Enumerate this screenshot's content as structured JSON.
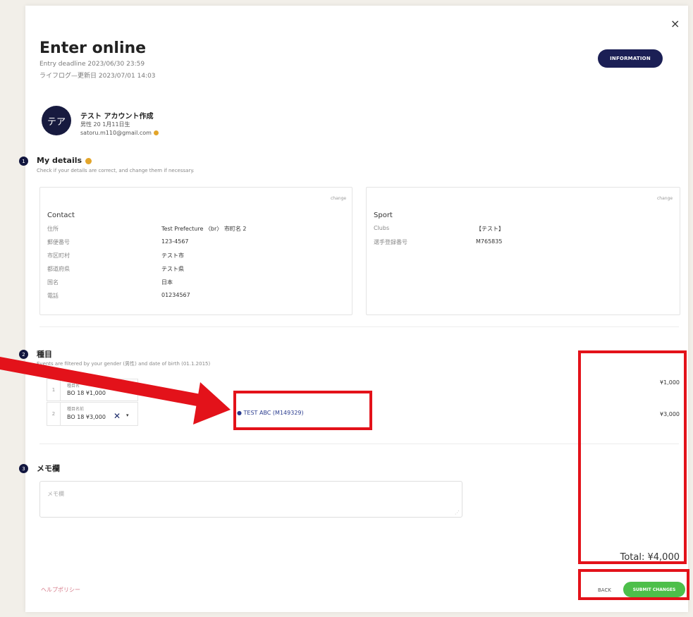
{
  "modal": {
    "close_label": "×",
    "title": "Enter online",
    "deadline_line": "Entry deadline 2023/06/30 23:59",
    "updated_line": "ライフログ—更新日 2023/07/01 14:03",
    "information_button": "INFORMATION"
  },
  "account": {
    "avatar_text": "テア",
    "name": "テスト アカウント作成",
    "sub_line": "男性 20 1月11日生",
    "email": "satoru.m110@gmail.com"
  },
  "sections": {
    "details": {
      "number": "1",
      "title": "My details",
      "note": "Check if your details are correct, and change them if necessary."
    },
    "events": {
      "number": "2",
      "title": "種目",
      "note": "Events are filtered by your gender (男性) and date of birth (01.1.2015)"
    },
    "memo": {
      "number": "3",
      "title": "メモ欄",
      "placeholder": "メモ欄"
    }
  },
  "contact_card": {
    "change": "change",
    "heading": "Contact",
    "rows": [
      {
        "label": "住所",
        "value": "Test Prefecture 〈br〉 市町名 2"
      },
      {
        "label": "郵便番号",
        "value": "123-4567"
      },
      {
        "label": "市区町村",
        "value": "テスト市"
      },
      {
        "label": "都道府県",
        "value": "テスト県"
      },
      {
        "label": "国名",
        "value": "日本"
      },
      {
        "label": "電話",
        "value": "01234567"
      }
    ]
  },
  "sport_card": {
    "change": "change",
    "heading": "Sport",
    "rows": [
      {
        "label": "Clubs",
        "value": "【テスト】"
      },
      {
        "label": "選手登録番号",
        "value": "M765835"
      }
    ]
  },
  "events": [
    {
      "num": "1",
      "category": "種目名",
      "line": "BO 18 ¥1,000",
      "price": "¥1,000"
    },
    {
      "num": "2",
      "category": "種目名前",
      "line": "BO 18 ¥3,000",
      "price": "¥3,000",
      "member": "TEST ABC (M149329)"
    }
  ],
  "totals": {
    "total": "Total: ¥4,000"
  },
  "footer": {
    "left_link": "ヘルプポリシー",
    "back": "BACK",
    "submit": "SUBMIT CHANGES"
  },
  "colors": {
    "navy": "#1b1f55",
    "green": "#4dbf4a",
    "annotation_red": "#e3121a"
  }
}
